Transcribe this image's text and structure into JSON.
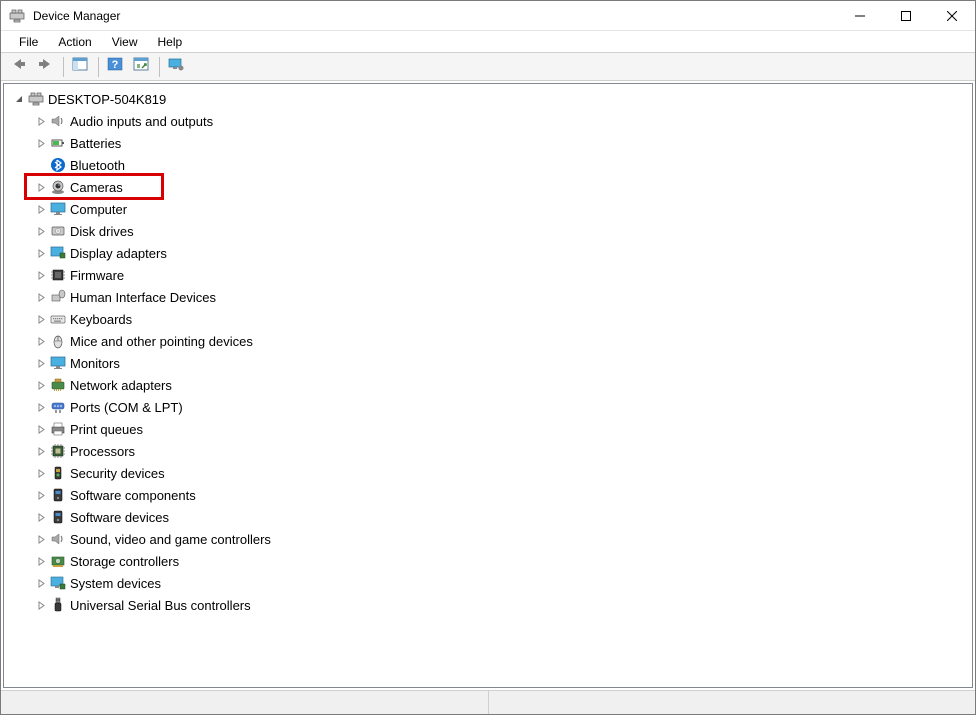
{
  "window": {
    "title": "Device Manager"
  },
  "menus": [
    {
      "label": "File"
    },
    {
      "label": "Action"
    },
    {
      "label": "View"
    },
    {
      "label": "Help"
    }
  ],
  "toolbar": {
    "back": "back-icon",
    "forward": "forward-icon",
    "show_hide_tree": "tree-pane-icon",
    "help": "help-icon",
    "scan": "scan-icon",
    "monitor": "monitor-icon"
  },
  "tree": {
    "root": {
      "label": "DESKTOP-504K819",
      "expanded": true,
      "icon": "computer-icon"
    },
    "children": [
      {
        "label": "Audio inputs and outputs",
        "icon": "speaker-icon",
        "highlighted": false
      },
      {
        "label": "Batteries",
        "icon": "battery-icon",
        "highlighted": false
      },
      {
        "label": "Bluetooth",
        "icon": "bluetooth-icon",
        "highlighted": false,
        "no_chevron": true
      },
      {
        "label": "Cameras",
        "icon": "camera-icon",
        "highlighted": true
      },
      {
        "label": "Computer",
        "icon": "monitor-icon",
        "highlighted": false
      },
      {
        "label": "Disk drives",
        "icon": "disk-icon",
        "highlighted": false
      },
      {
        "label": "Display adapters",
        "icon": "display-adapter-icon",
        "highlighted": false
      },
      {
        "label": "Firmware",
        "icon": "chip-icon",
        "highlighted": false
      },
      {
        "label": "Human Interface Devices",
        "icon": "hid-icon",
        "highlighted": false
      },
      {
        "label": "Keyboards",
        "icon": "keyboard-icon",
        "highlighted": false
      },
      {
        "label": "Mice and other pointing devices",
        "icon": "mouse-icon",
        "highlighted": false
      },
      {
        "label": "Monitors",
        "icon": "monitor-icon",
        "highlighted": false
      },
      {
        "label": "Network adapters",
        "icon": "network-icon",
        "highlighted": false
      },
      {
        "label": "Ports (COM & LPT)",
        "icon": "port-icon",
        "highlighted": false
      },
      {
        "label": "Print queues",
        "icon": "printer-icon",
        "highlighted": false
      },
      {
        "label": "Processors",
        "icon": "cpu-icon",
        "highlighted": false
      },
      {
        "label": "Security devices",
        "icon": "security-icon",
        "highlighted": false
      },
      {
        "label": "Software components",
        "icon": "software-icon",
        "highlighted": false
      },
      {
        "label": "Software devices",
        "icon": "software-icon",
        "highlighted": false
      },
      {
        "label": "Sound, video and game controllers",
        "icon": "speaker-icon",
        "highlighted": false
      },
      {
        "label": "Storage controllers",
        "icon": "storage-icon",
        "highlighted": false
      },
      {
        "label": "System devices",
        "icon": "system-icon",
        "highlighted": false
      },
      {
        "label": "Universal Serial Bus controllers",
        "icon": "usb-icon",
        "highlighted": false
      }
    ]
  }
}
